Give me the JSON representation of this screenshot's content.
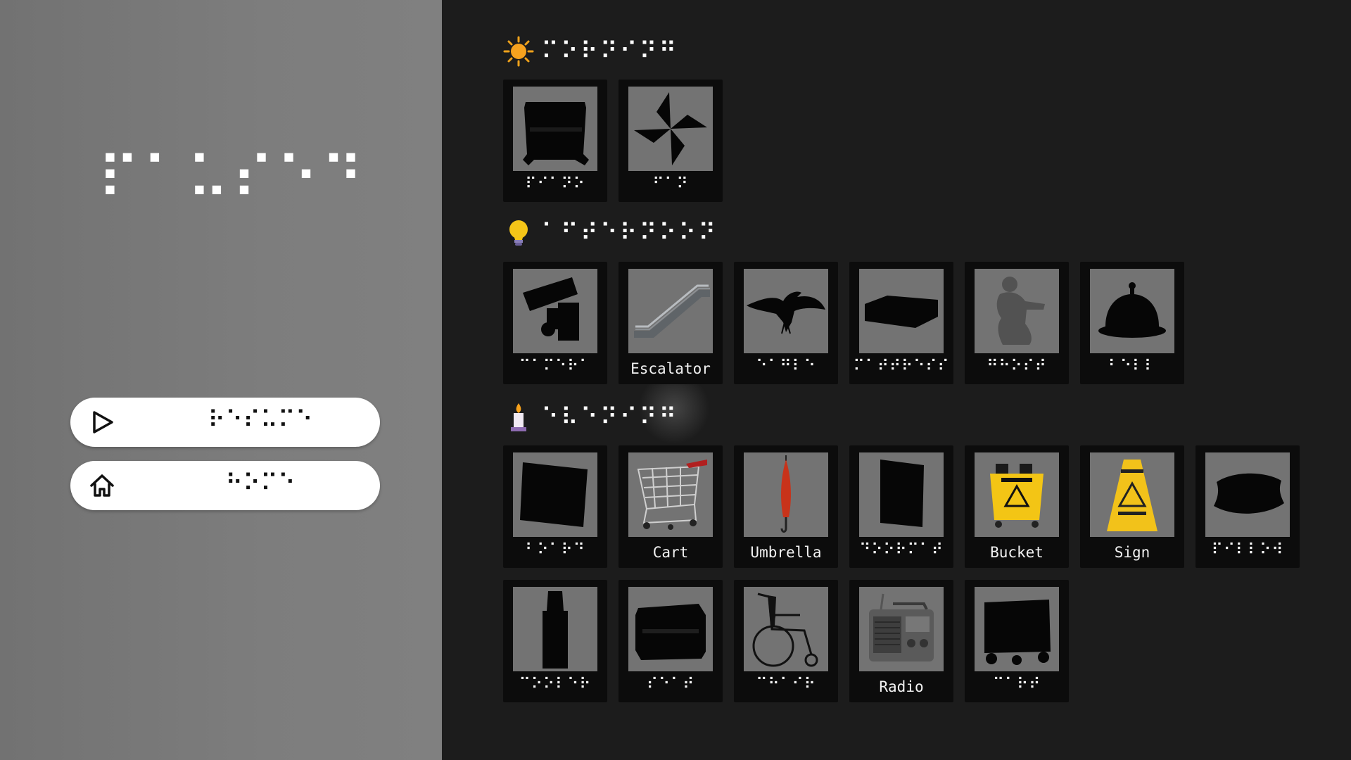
{
  "menu": {
    "title": "⠏⠁⠥⠎⠑⠙",
    "buttons": [
      {
        "label": "⠗⠑⠎⠥⠍⠑",
        "icon": "play-icon"
      },
      {
        "label": "⠓⠕⠍⠑",
        "icon": "home-icon"
      }
    ]
  },
  "sections": [
    {
      "label": "⠍⠕⠗⠝⠊⠝⠛",
      "icon": "sun-icon",
      "items": [
        {
          "label": "⠏⠊⠁⠝⠕",
          "icon": "piano-icon",
          "braille": true
        },
        {
          "label": "⠋⠁⠝",
          "icon": "pinwheel-icon",
          "braille": true
        }
      ]
    },
    {
      "label": "⠁⠋⠞⠑⠗⠝⠕⠕⠝",
      "icon": "lightbulb-icon",
      "items": [
        {
          "label": "⠉⠁⠍⠑⠗⠁",
          "icon": "camera-icon",
          "braille": true
        },
        {
          "label": "Escalator",
          "icon": "escalator-icon",
          "braille": false
        },
        {
          "label": "⠑⠁⠛⠇⠑",
          "icon": "eagle-icon",
          "braille": true
        },
        {
          "label": "⠍⠁⠞⠞⠗⠑⠎⠎",
          "icon": "mattress-icon",
          "braille": true
        },
        {
          "label": "⠛⠓⠕⠎⠞",
          "icon": "ghost-figure-icon",
          "braille": true
        },
        {
          "label": "⠃⠑⠇⠇",
          "icon": "bell-icon",
          "braille": true
        }
      ]
    },
    {
      "label": "⠑⠧⠑⠝⠊⠝⠛",
      "icon": "candle-icon",
      "items": [
        {
          "label": "⠃⠕⠁⠗⠙",
          "icon": "board-icon",
          "braille": true
        },
        {
          "label": "Cart",
          "icon": "cart-icon",
          "braille": false
        },
        {
          "label": "Umbrella",
          "icon": "umbrella-icon",
          "braille": false
        },
        {
          "label": "⠙⠕⠕⠗⠍⠁⠞",
          "icon": "door-icon",
          "braille": true
        },
        {
          "label": "Bucket",
          "icon": "bucket-icon",
          "braille": false
        },
        {
          "label": "Sign",
          "icon": "wet-floor-sign-icon",
          "braille": false
        },
        {
          "label": "⠏⠊⠇⠇⠕⠺",
          "icon": "pillow-icon",
          "braille": true
        },
        {
          "label": "⠉⠕⠕⠇⠑⠗",
          "icon": "water-cooler-icon",
          "braille": true
        },
        {
          "label": "⠎⠑⠁⠞",
          "icon": "seat-icon",
          "braille": true
        },
        {
          "label": "⠉⠓⠁⠊⠗",
          "icon": "wheelchair-icon",
          "braille": true
        },
        {
          "label": "Radio",
          "icon": "radio-icon",
          "braille": false
        },
        {
          "label": "⠉⠁⠗⠞",
          "icon": "trolley-icon",
          "braille": true
        }
      ]
    }
  ]
}
